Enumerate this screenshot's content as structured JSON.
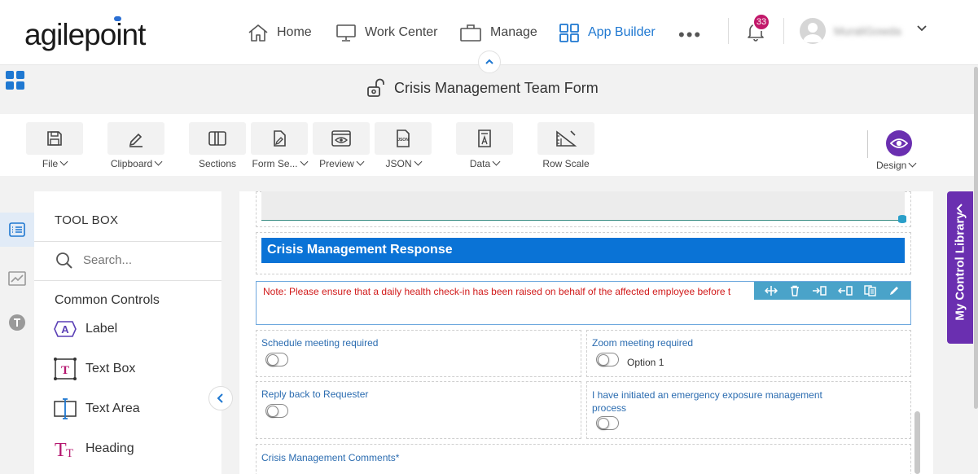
{
  "brand": {
    "logo_text": "agilepoint",
    "accent": "#2b6fd3"
  },
  "nav": {
    "items": [
      {
        "label": "Home",
        "icon": "home-icon"
      },
      {
        "label": "Work Center",
        "icon": "monitor-icon"
      },
      {
        "label": "Manage",
        "icon": "briefcase-icon"
      },
      {
        "label": "App Builder",
        "icon": "grid-icon",
        "active": true
      }
    ],
    "more_label": "•••",
    "notifications_count": "33",
    "username": "MuraliGowda"
  },
  "title_bar": {
    "form_title": "Crisis Management Team Form"
  },
  "toolbar": {
    "file": "File",
    "clipboard": "Clipboard",
    "sections": "Sections",
    "form_settings": "Form Se...",
    "preview": "Preview",
    "json": "JSON",
    "data": "Data",
    "row_scale": "Row Scale",
    "design": "Design"
  },
  "toolbox": {
    "title": "TOOL BOX",
    "search_placeholder": "Search...",
    "section_label": "Common Controls",
    "items": [
      {
        "label": "Label",
        "icon": "label-control-icon"
      },
      {
        "label": "Text Box",
        "icon": "textbox-control-icon"
      },
      {
        "label": "Text Area",
        "icon": "textarea-control-icon"
      },
      {
        "label": "Heading",
        "icon": "heading-control-icon"
      }
    ]
  },
  "canvas": {
    "section_header": "Crisis Management Response",
    "note": "Note: Please ensure that a daily health check-in has been raised on behalf of the affected employee before t",
    "fields": {
      "schedule_meeting": "Schedule meeting required",
      "zoom_meeting": "Zoom meeting required",
      "zoom_option": "Option 1",
      "reply_back": "Reply back to Requester",
      "emergency_exposure": "I have initiated an emergency exposure management process",
      "comments": "Crisis Management Comments*"
    }
  },
  "control_library": {
    "label": "My Control Library"
  },
  "colors": {
    "accent_blue": "#1f78d1",
    "section_blue": "#0a73d6",
    "purple": "#6a2fb0",
    "note_red": "#d11a1a",
    "badge": "#c2186a"
  }
}
